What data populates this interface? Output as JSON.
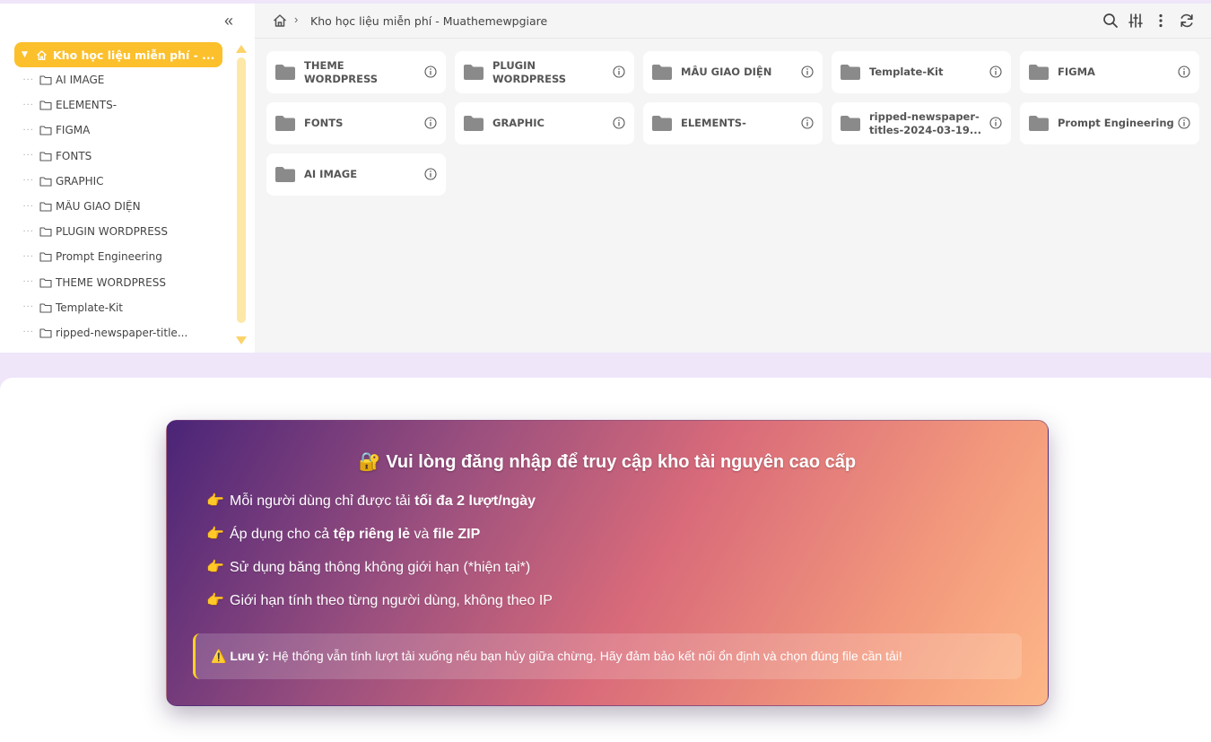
{
  "breadcrumb": {
    "current": "Kho học liệu miễn phí - Muathemewpgiare"
  },
  "sidebar": {
    "root_label": "Kho học liệu miễn phí - ...",
    "items": [
      "AI IMAGE",
      "ELEMENTS-",
      "FIGMA",
      "FONTS",
      "GRAPHIC",
      "MẪU GIAO DIỆN",
      "PLUGIN WORDPRESS",
      "Prompt Engineering",
      "THEME WORDPRESS",
      "Template-Kit",
      "ripped-newspaper-title..."
    ]
  },
  "folders": [
    "THEME WORDPRESS",
    "PLUGIN WORDPRESS",
    "MẪU GIAO DIỆN",
    "Template-Kit",
    "FIGMA",
    "FONTS",
    "GRAPHIC",
    "ELEMENTS-",
    "ripped-newspaper-titles-2024-03-19...",
    "Prompt Engineering",
    "AI IMAGE"
  ],
  "toolbar_icons": [
    "search-icon",
    "sliders-icon",
    "more-vertical-icon",
    "refresh-icon"
  ],
  "promo": {
    "title": "🔐 Vui lòng đăng nhập để truy cập kho tài nguyên cao cấp",
    "items": [
      {
        "prefix": "Mỗi người dùng chỉ được tải ",
        "bold": "tối đa 2 lượt/ngày",
        "mid": "",
        "bold2": ""
      },
      {
        "prefix": "Áp dụng cho cả ",
        "bold": "tệp riêng lẻ",
        "mid": " và ",
        "bold2": "file ZIP"
      },
      {
        "prefix": "Sử dụng băng thông không giới hạn (*hiện tại*)",
        "bold": "",
        "mid": "",
        "bold2": ""
      },
      {
        "prefix": "Giới hạn tính theo từng người dùng, không theo IP",
        "bold": "",
        "mid": "",
        "bold2": ""
      }
    ],
    "hand": "👉",
    "note_icon": "⚠️",
    "note_label": "Lưu ý:",
    "note_text": " Hệ thống vẫn tính lượt tải xuống nếu bạn hủy giữa chừng. Hãy đảm bảo kết nối ổn định và chọn đúng file cần tải!"
  },
  "colors": {
    "accent": "#fcc02c",
    "folder": "#8a8a8a",
    "promo_start": "#4a2478",
    "promo_end": "#fdb787",
    "note_border": "#ffd21f"
  }
}
